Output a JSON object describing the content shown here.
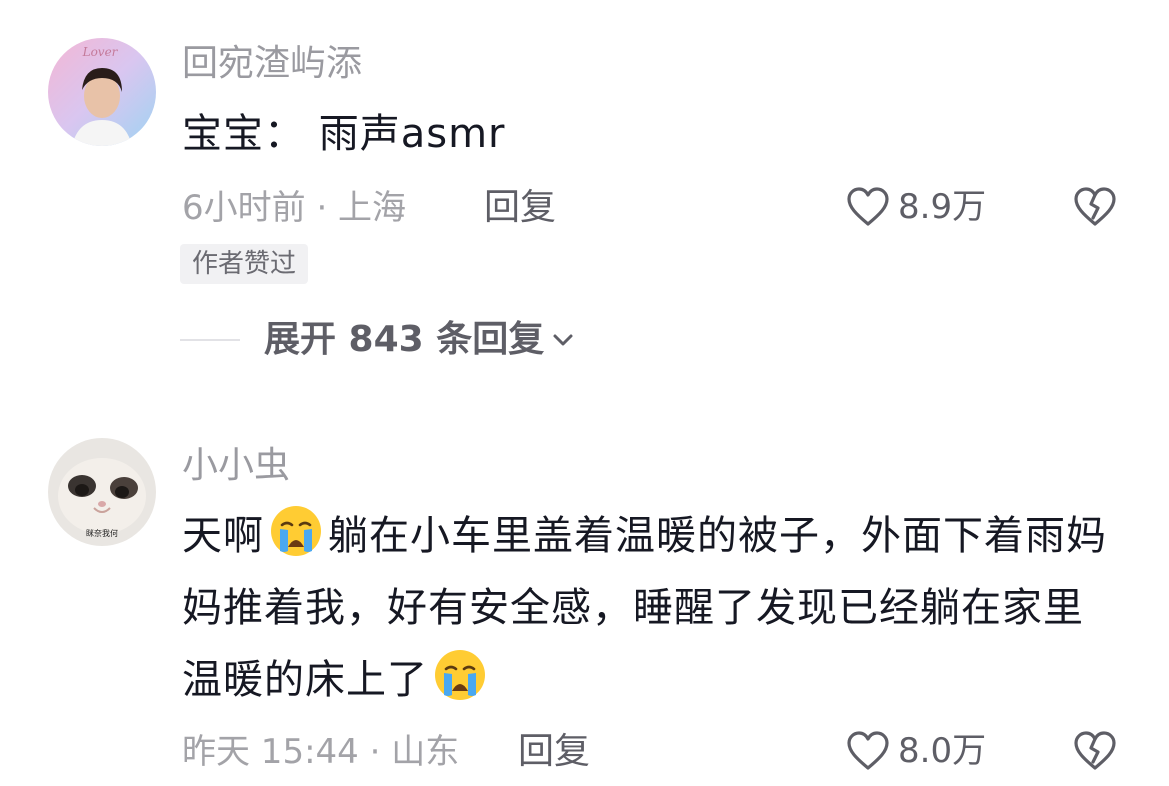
{
  "comments": [
    {
      "username": "回宛渣屿添",
      "content": "宝宝： 雨声asmr",
      "time_location": "6小时前 · 上海",
      "reply_label": "回复",
      "like_count": "8.9万",
      "badge": "作者赞过",
      "avatar_text": "Lover",
      "expand_label": "展开 843 条回复"
    },
    {
      "username": "小小虫",
      "content_part1": "天啊",
      "content_part2": "躺在小车里盖着温暖的被子，外面下着雨妈妈推着我，好有安全感，睡醒了发现已经躺在家里温暖的床上了",
      "time_location": "昨天 15:44 · 山东",
      "reply_label": "回复",
      "like_count": "8.0万",
      "avatar_text": "眯奈我何"
    }
  ],
  "icons": {
    "like": "heart-outline-icon",
    "dislike": "broken-heart-icon",
    "emoji": "crying-face-emoji",
    "expand": "chevron-down-icon"
  },
  "colors": {
    "text_primary": "#161823",
    "text_secondary": "#a3a3a8",
    "text_action": "#5e5e66",
    "badge_bg": "#f1f1f3"
  }
}
